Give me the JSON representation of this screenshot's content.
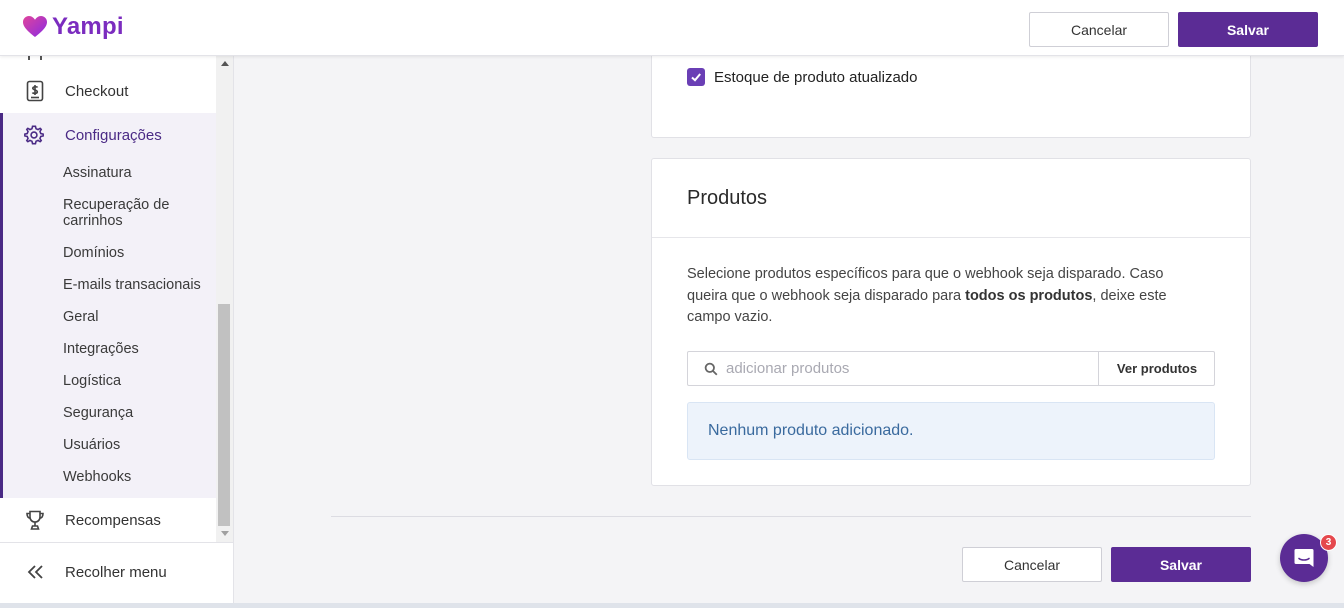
{
  "app": {
    "brand": "Yampi",
    "accent": "#5b2c95",
    "brand_color": "#7b2cbf"
  },
  "header": {
    "cancel_label": "Cancelar",
    "save_label": "Salvar"
  },
  "sidebar": {
    "items": [
      {
        "label": "Checkout",
        "icon": "receipt-dollar-icon"
      },
      {
        "label": "Configurações",
        "icon": "gear-icon",
        "active": true
      },
      {
        "label": "Recompensas",
        "icon": "trophy-icon"
      }
    ],
    "config_subitems": [
      "Assinatura",
      "Recuperação de carrinhos",
      "Domínios",
      "E-mails transacionais",
      "Geral",
      "Integrações",
      "Logística",
      "Segurança",
      "Usuários",
      "Webhooks"
    ],
    "collapse_label": "Recolher menu"
  },
  "events_card": {
    "checkbox_label": "Estoque de produto atualizado",
    "checked": true
  },
  "products_card": {
    "title": "Produtos",
    "desc_before": "Selecione produtos específicos para que o webhook seja disparado. Caso queira que o webhook seja disparado para ",
    "desc_bold": "todos os produtos",
    "desc_after": ", deixe este campo vazio.",
    "search_placeholder": "adicionar produtos",
    "search_value": "",
    "view_button_label": "Ver produtos",
    "empty_message": "Nenhum produto adicionado."
  },
  "footer": {
    "cancel_label": "Cancelar",
    "save_label": "Salvar"
  },
  "chat": {
    "badge_count": "3",
    "icon": "chat-icon"
  }
}
